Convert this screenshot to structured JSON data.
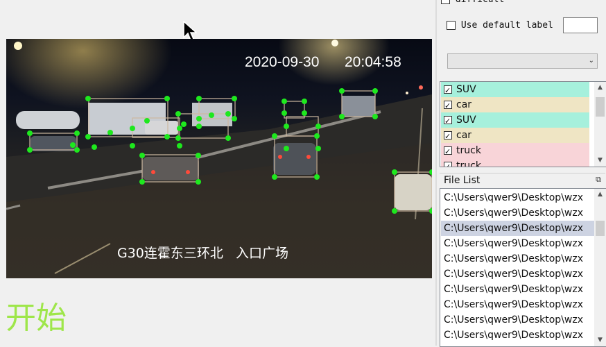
{
  "video": {
    "timestamp_date": "2020-09-30",
    "timestamp_time": "20:04:58",
    "caption": "G30连霍东三环北   入口广场"
  },
  "start_label": "开始",
  "panel": {
    "difficult_label": "difficult",
    "use_default_label": "Use default label",
    "default_label_value": "",
    "label_combo_value": "",
    "labels": [
      {
        "text": "SUV",
        "color": "#a6f0dc",
        "checked": true
      },
      {
        "text": "car",
        "color": "#efe5c4",
        "checked": true
      },
      {
        "text": "SUV",
        "color": "#a6f0dc",
        "checked": true
      },
      {
        "text": "car",
        "color": "#efe5c4",
        "checked": true
      },
      {
        "text": "truck",
        "color": "#f8d4d8",
        "checked": true
      },
      {
        "text": "truck",
        "color": "#f8d4d8",
        "checked": true
      }
    ],
    "file_list_title": "File List",
    "files": [
      "C:\\Users\\qwer9\\Desktop\\wzx",
      "C:\\Users\\qwer9\\Desktop\\wzx",
      "C:\\Users\\qwer9\\Desktop\\wzx",
      "C:\\Users\\qwer9\\Desktop\\wzx",
      "C:\\Users\\qwer9\\Desktop\\wzx",
      "C:\\Users\\qwer9\\Desktop\\wzx",
      "C:\\Users\\qwer9\\Desktop\\wzx",
      "C:\\Users\\qwer9\\Desktop\\wzx",
      "C:\\Users\\qwer9\\Desktop\\wzx",
      "C:\\Users\\qwer9\\Desktop\\wzx"
    ],
    "selected_file_index": 2
  },
  "colors": {
    "point": "#1ee81e",
    "box": "#cdb8a0",
    "selected_row": "#cdd3e2"
  }
}
